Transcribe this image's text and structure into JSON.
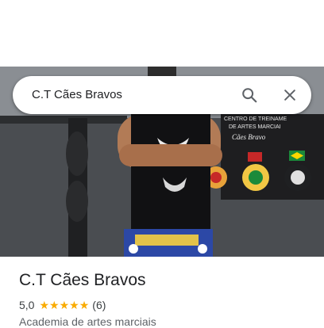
{
  "search": {
    "query": "C.T Cães Bravos"
  },
  "place": {
    "name": "C.T Cães Bravos",
    "rating": "5,0",
    "stars": 5,
    "review_count": "(6)",
    "category": "Academia de artes marciais"
  },
  "photo_banner": {
    "line1": "CENTRO DE TREINAME",
    "line2": "DE ARTES MARCIAI",
    "line3": "Cães Bravo"
  },
  "icons": {
    "search": "search-icon",
    "clear": "close-icon",
    "star": "star-icon"
  },
  "colors": {
    "star": "#f9ab00",
    "text_primary": "#202124",
    "text_secondary": "#5f6368"
  }
}
